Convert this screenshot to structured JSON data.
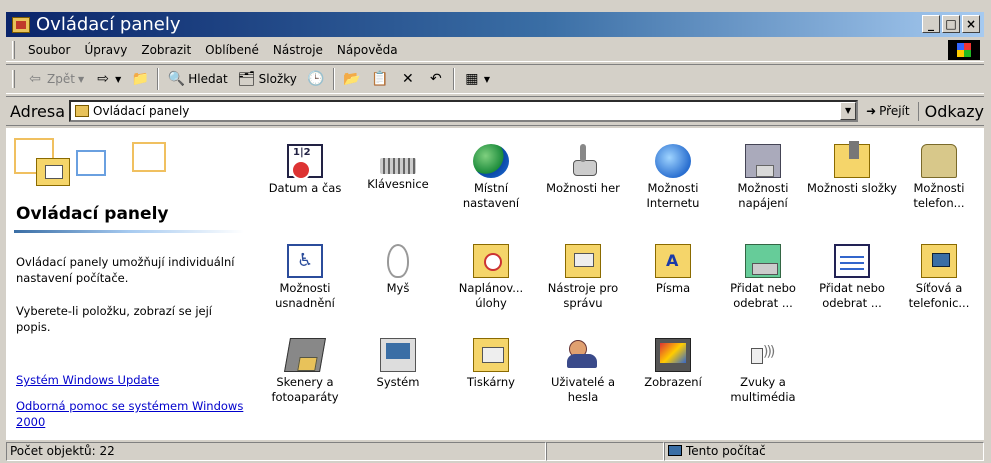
{
  "window": {
    "title": "Ovládací panely",
    "controls": {
      "minimize": "_",
      "maximize": "□",
      "close": "×"
    }
  },
  "menubar": {
    "items": [
      "Soubor",
      "Úpravy",
      "Zobrazit",
      "Oblíbené",
      "Nástroje",
      "Nápověda"
    ]
  },
  "toolbar": {
    "back": "Zpět",
    "search": "Hledat",
    "folders": "Složky",
    "icons": {
      "back": "back-arrow-icon",
      "forward": "forward-arrow-icon",
      "up": "up-folder-icon",
      "search": "search-icon",
      "folders": "folders-icon",
      "history": "history-icon",
      "move": "move-to-icon",
      "copy": "copy-to-icon",
      "delete": "delete-icon",
      "undo": "undo-icon",
      "views": "views-icon"
    }
  },
  "addressbar": {
    "label": "Adresa",
    "value": "Ovládací panely",
    "go": "Přejít",
    "links": "Odkazy"
  },
  "left_pane": {
    "title": "Ovládací panely",
    "description": "Ovládací panely umožňují individuální nastavení počítače.",
    "hint": "Vyberete-li položku, zobrazí se její popis.",
    "links": [
      "Systém Windows Update",
      "Odborná pomoc se systémem Windows 2000"
    ]
  },
  "items": [
    {
      "label": "Datum a čas",
      "icon": "date-time-icon"
    },
    {
      "label": "Klávesnice",
      "icon": "keyboard-icon"
    },
    {
      "label": "Místní nastavení",
      "icon": "regional-settings-icon"
    },
    {
      "label": "Možnosti her",
      "icon": "game-options-icon"
    },
    {
      "label": "Možnosti Internetu",
      "icon": "internet-options-icon"
    },
    {
      "label": "Možnosti napájení",
      "icon": "power-options-icon"
    },
    {
      "label": "Možnosti složky",
      "icon": "folder-options-icon"
    },
    {
      "label": "Možnosti telefon...",
      "icon": "phone-options-icon"
    },
    {
      "label": "Možnosti usnadnění",
      "icon": "accessibility-icon"
    },
    {
      "label": "Myš",
      "icon": "mouse-icon"
    },
    {
      "label": "Naplánov... úlohy",
      "icon": "scheduled-tasks-icon"
    },
    {
      "label": "Nástroje pro správu",
      "icon": "admin-tools-icon"
    },
    {
      "label": "Písma",
      "icon": "fonts-icon"
    },
    {
      "label": "Přidat nebo odebrat ...",
      "icon": "add-remove-programs-icon"
    },
    {
      "label": "Přidat nebo odebrat ...",
      "icon": "add-remove-hardware-icon"
    },
    {
      "label": "Síťová a telefonic...",
      "icon": "network-icon"
    },
    {
      "label": "Skenery a fotoaparáty",
      "icon": "scanner-icon"
    },
    {
      "label": "Systém",
      "icon": "system-icon"
    },
    {
      "label": "Tiskárny",
      "icon": "printers-icon"
    },
    {
      "label": "Uživatelé a hesla",
      "icon": "users-icon"
    },
    {
      "label": "Zobrazení",
      "icon": "display-icon"
    },
    {
      "label": "Zvuky a multimédia",
      "icon": "sounds-icon"
    }
  ],
  "statusbar": {
    "count": "Počet objektů: 22",
    "location": "Tento počítač"
  }
}
